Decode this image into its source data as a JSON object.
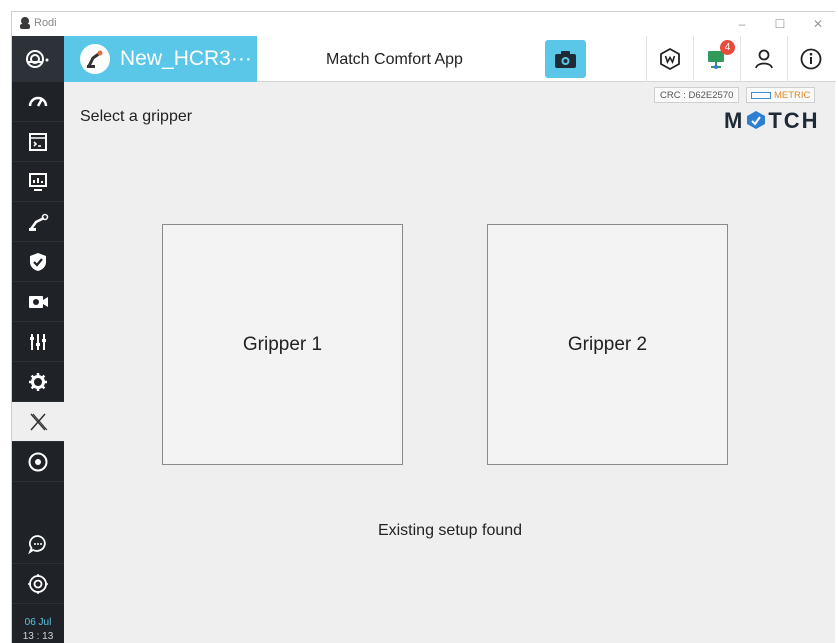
{
  "window": {
    "app_name": "Rodi",
    "minimize": "–",
    "maximize": "☐",
    "close": "✕"
  },
  "header": {
    "project_name": "New_HCR3···",
    "app_title": "Match Comfort App",
    "notification_count": "4"
  },
  "sidebar": {
    "date": "06 Jul",
    "time": "13 : 13",
    "active_item": "x-app"
  },
  "main": {
    "select_label": "Select a gripper",
    "crc": "CRC : D62E2570",
    "unit": "METRIC",
    "brand_left": "M",
    "brand_right": "TCH",
    "grippers": [
      {
        "label": "Gripper 1"
      },
      {
        "label": "Gripper 2"
      }
    ],
    "status": "Existing setup found"
  },
  "colors": {
    "accent": "#5bc7e8",
    "sidebar": "#1f2327",
    "badge": "#e94c3d",
    "metric": "#e08a2a",
    "brand": "#1f2a36"
  }
}
